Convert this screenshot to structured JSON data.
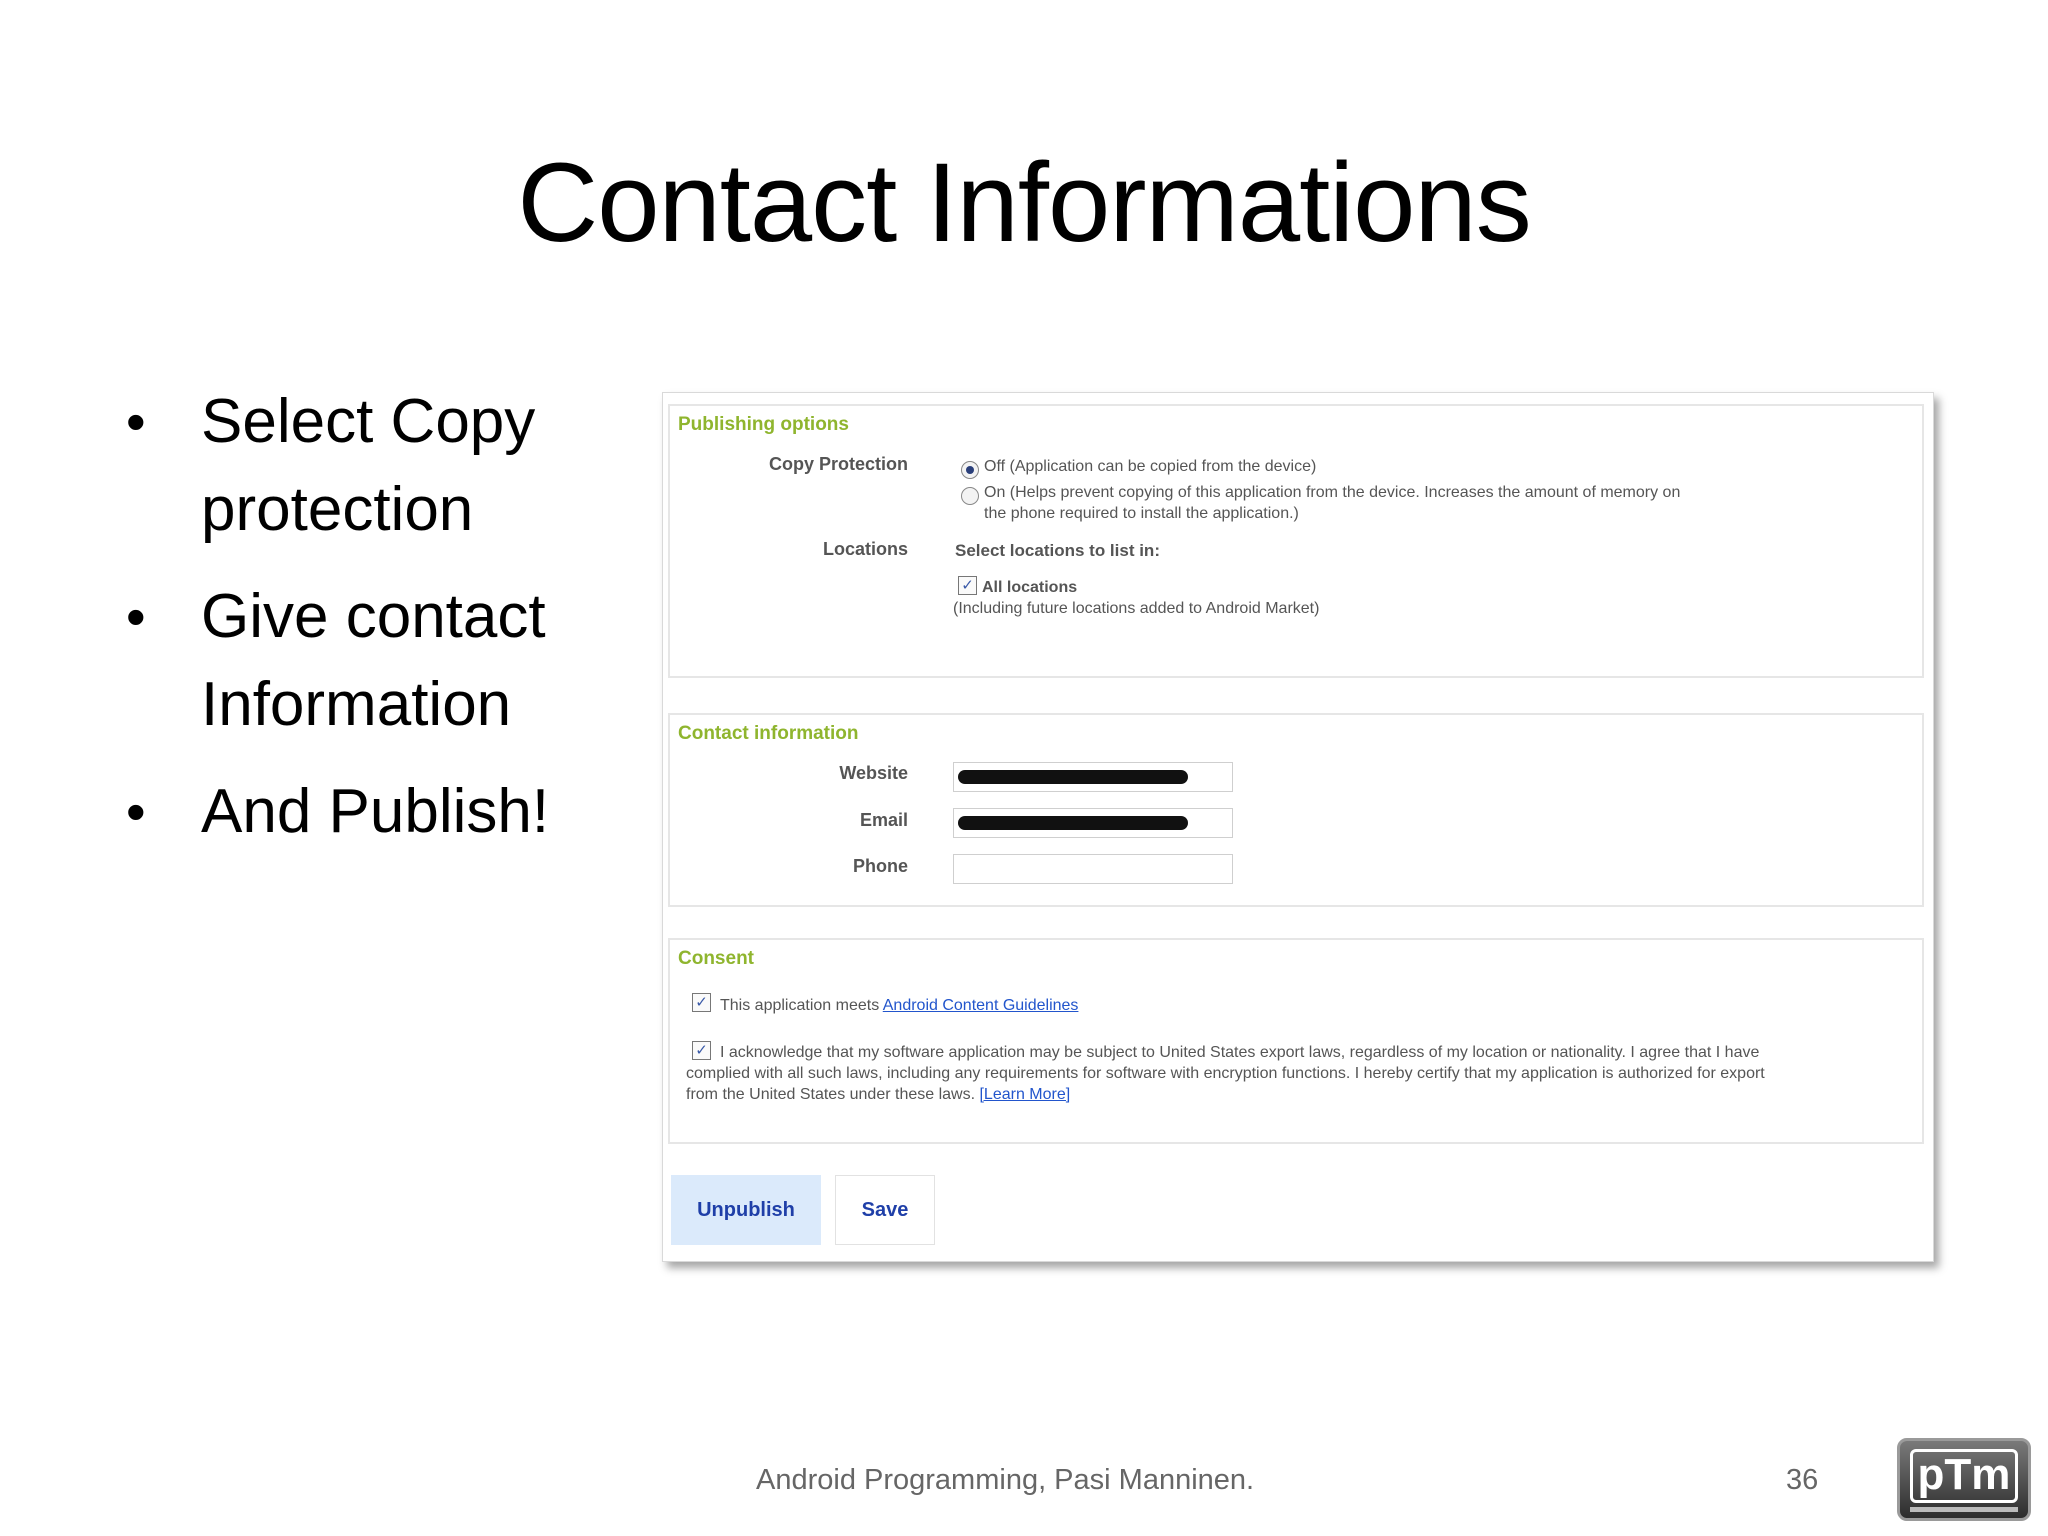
{
  "slide": {
    "title": "Contact Informations",
    "bullets": [
      "Select Copy protection",
      "Give contact Information",
      "And Publish!"
    ],
    "footer": "Android Programming, Pasi Manninen.",
    "page_number": "36",
    "logo_text": "pTm"
  },
  "publishing": {
    "title": "Publishing options",
    "copy_protection_label": "Copy Protection",
    "option_off": "Off (Application can be copied from the device)",
    "option_on_line1": "On (Helps prevent copying of this application from the device. Increases the amount of memory on",
    "option_on_line2": "the phone required to install the application.)",
    "selected": "off",
    "locations_label": "Locations",
    "locations_prompt": "Select locations to list in:",
    "all_locations_label": "All locations",
    "all_locations_checked": true,
    "locations_note": "(Including future locations added to Android Market)"
  },
  "contact": {
    "title": "Contact information",
    "website_label": "Website",
    "email_label": "Email",
    "phone_label": "Phone"
  },
  "consent": {
    "title": "Consent",
    "guidelines_prefix": "This application meets ",
    "guidelines_link": "Android Content Guidelines",
    "export_text_line1": "I acknowledge that my software application may be subject to United States export laws, regardless of my location or nationality. I agree that I have",
    "export_text_line2": "complied with all such laws, including any requirements for software with encryption functions. I hereby certify that my application is authorized for export",
    "export_text_line3": "from the United States under these laws. ",
    "learn_more": "[Learn More]"
  },
  "buttons": {
    "unpublish": "Unpublish",
    "save": "Save"
  },
  "colors": {
    "section_title": "#8fb52e",
    "button_text": "#1f3fa8",
    "unpublish_bg": "#dbeafb",
    "link": "#2255cc"
  }
}
